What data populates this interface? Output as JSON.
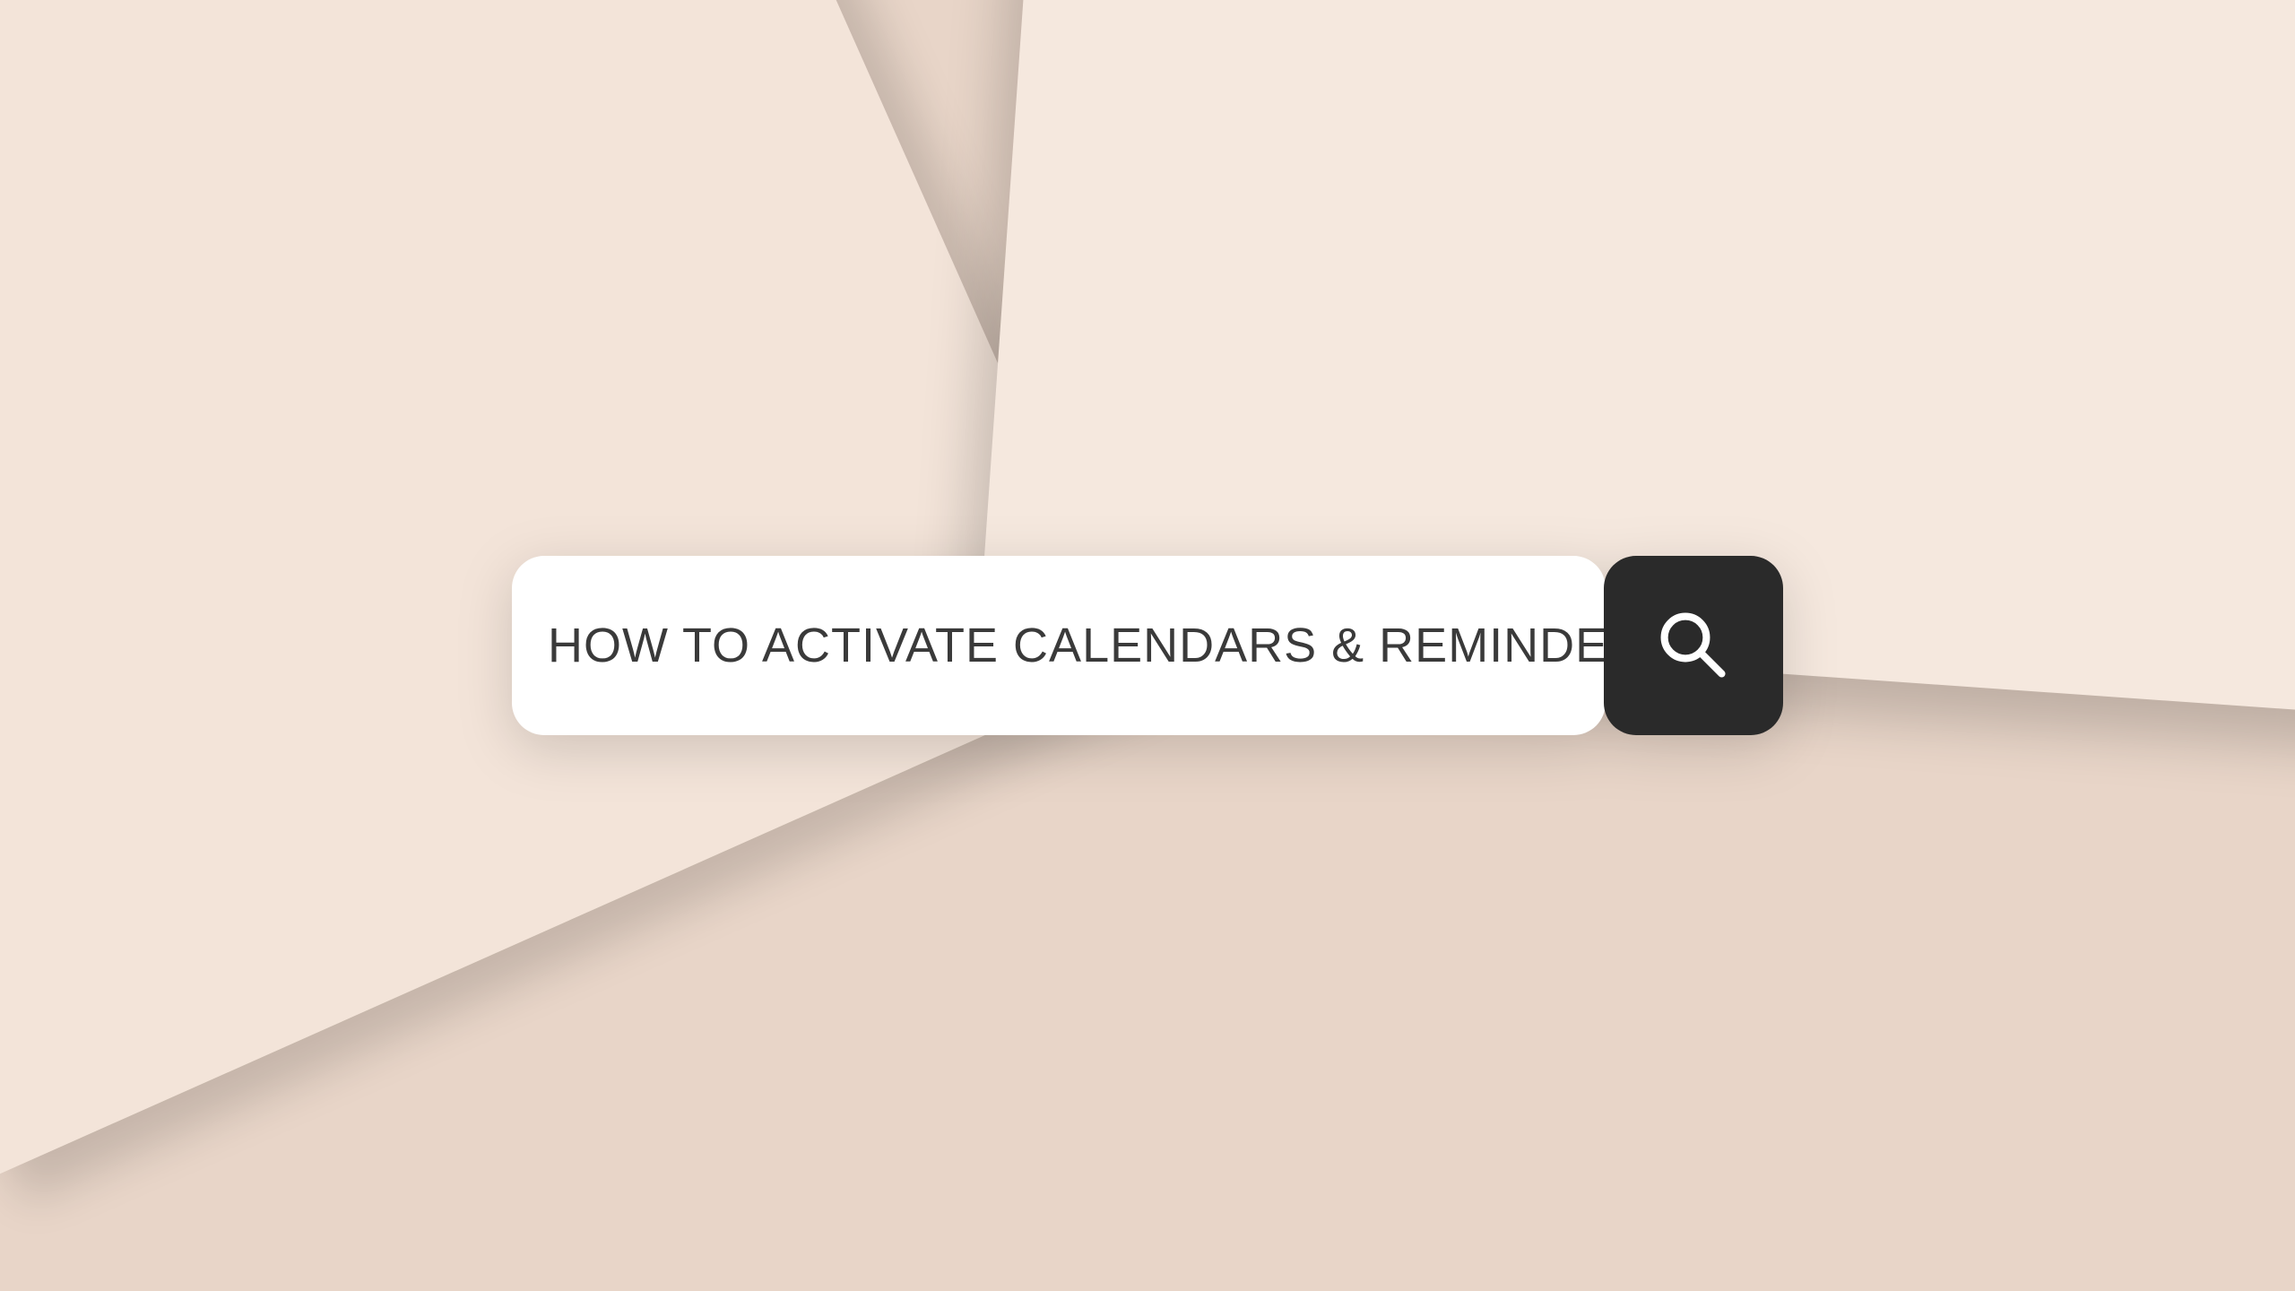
{
  "search": {
    "query": "HOW TO ACTIVATE CALENDARS & REMINDERS"
  },
  "colors": {
    "background": "#e8d5c8",
    "paper1": "#f3e4d9",
    "paper2": "#f5e8de",
    "searchBg": "#ffffff",
    "buttonBg": "#2a2a2a",
    "textColor": "#3a3a3a"
  }
}
